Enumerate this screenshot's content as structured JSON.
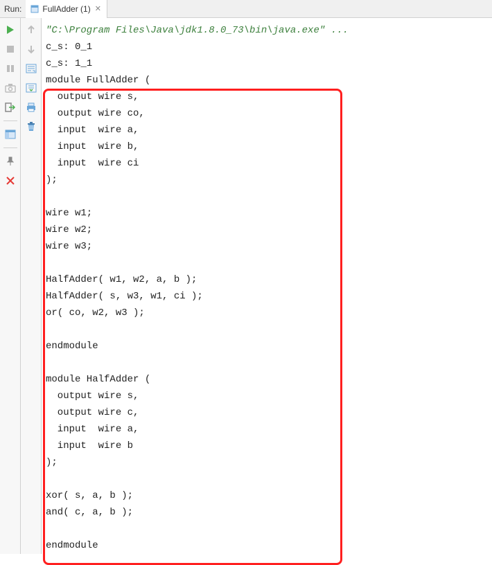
{
  "header": {
    "run_label": "Run:",
    "tab_label": "FullAdder (1)"
  },
  "gutter1": {
    "run": "run-icon",
    "stop": "stop-icon",
    "pause": "pause-icon",
    "camera": "camera-icon",
    "logout": "logout-icon",
    "layout": "layout-icon",
    "pin": "pin-icon",
    "close": "close-icon"
  },
  "gutter2": {
    "up": "arrow-up-icon",
    "down": "arrow-down-icon",
    "tree1": "tree-icon",
    "tree2": "tree2-icon",
    "print": "print-icon",
    "trash": "trash-icon"
  },
  "code": {
    "cmd": "\"C:\\Program Files\\Java\\jdk1.8.0_73\\bin\\java.exe\" ...",
    "out1": "c_s: 0_1",
    "out2": "c_s: 1_1",
    "lines": [
      "module FullAdder (",
      "  output wire s,",
      "  output wire co,",
      "  input  wire a,",
      "  input  wire b,",
      "  input  wire ci",
      ");",
      "",
      "wire w1;",
      "wire w2;",
      "wire w3;",
      "",
      "HalfAdder( w1, w2, a, b );",
      "HalfAdder( s, w3, w1, ci );",
      "or( co, w2, w3 );",
      "",
      "endmodule",
      "",
      "module HalfAdder (",
      "  output wire s,",
      "  output wire c,",
      "  input  wire a,",
      "  input  wire b",
      ");",
      "",
      "xor( s, a, b );",
      "and( c, a, b );",
      "",
      "endmodule"
    ]
  }
}
